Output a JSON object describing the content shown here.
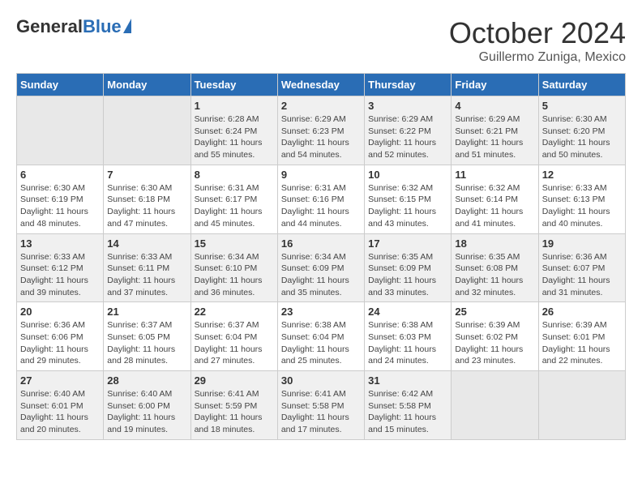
{
  "logo": {
    "general": "General",
    "blue": "Blue"
  },
  "title": {
    "month": "October 2024",
    "location": "Guillermo Zuniga, Mexico"
  },
  "weekdays": [
    "Sunday",
    "Monday",
    "Tuesday",
    "Wednesday",
    "Thursday",
    "Friday",
    "Saturday"
  ],
  "weeks": [
    [
      {
        "day": "",
        "empty": true
      },
      {
        "day": "",
        "empty": true
      },
      {
        "day": "1",
        "sunrise": "6:28 AM",
        "sunset": "6:24 PM",
        "daylight": "11 hours and 55 minutes."
      },
      {
        "day": "2",
        "sunrise": "6:29 AM",
        "sunset": "6:23 PM",
        "daylight": "11 hours and 54 minutes."
      },
      {
        "day": "3",
        "sunrise": "6:29 AM",
        "sunset": "6:22 PM",
        "daylight": "11 hours and 52 minutes."
      },
      {
        "day": "4",
        "sunrise": "6:29 AM",
        "sunset": "6:21 PM",
        "daylight": "11 hours and 51 minutes."
      },
      {
        "day": "5",
        "sunrise": "6:30 AM",
        "sunset": "6:20 PM",
        "daylight": "11 hours and 50 minutes."
      }
    ],
    [
      {
        "day": "6",
        "sunrise": "6:30 AM",
        "sunset": "6:19 PM",
        "daylight": "11 hours and 48 minutes."
      },
      {
        "day": "7",
        "sunrise": "6:30 AM",
        "sunset": "6:18 PM",
        "daylight": "11 hours and 47 minutes."
      },
      {
        "day": "8",
        "sunrise": "6:31 AM",
        "sunset": "6:17 PM",
        "daylight": "11 hours and 45 minutes."
      },
      {
        "day": "9",
        "sunrise": "6:31 AM",
        "sunset": "6:16 PM",
        "daylight": "11 hours and 44 minutes."
      },
      {
        "day": "10",
        "sunrise": "6:32 AM",
        "sunset": "6:15 PM",
        "daylight": "11 hours and 43 minutes."
      },
      {
        "day": "11",
        "sunrise": "6:32 AM",
        "sunset": "6:14 PM",
        "daylight": "11 hours and 41 minutes."
      },
      {
        "day": "12",
        "sunrise": "6:33 AM",
        "sunset": "6:13 PM",
        "daylight": "11 hours and 40 minutes."
      }
    ],
    [
      {
        "day": "13",
        "sunrise": "6:33 AM",
        "sunset": "6:12 PM",
        "daylight": "11 hours and 39 minutes."
      },
      {
        "day": "14",
        "sunrise": "6:33 AM",
        "sunset": "6:11 PM",
        "daylight": "11 hours and 37 minutes."
      },
      {
        "day": "15",
        "sunrise": "6:34 AM",
        "sunset": "6:10 PM",
        "daylight": "11 hours and 36 minutes."
      },
      {
        "day": "16",
        "sunrise": "6:34 AM",
        "sunset": "6:09 PM",
        "daylight": "11 hours and 35 minutes."
      },
      {
        "day": "17",
        "sunrise": "6:35 AM",
        "sunset": "6:09 PM",
        "daylight": "11 hours and 33 minutes."
      },
      {
        "day": "18",
        "sunrise": "6:35 AM",
        "sunset": "6:08 PM",
        "daylight": "11 hours and 32 minutes."
      },
      {
        "day": "19",
        "sunrise": "6:36 AM",
        "sunset": "6:07 PM",
        "daylight": "11 hours and 31 minutes."
      }
    ],
    [
      {
        "day": "20",
        "sunrise": "6:36 AM",
        "sunset": "6:06 PM",
        "daylight": "11 hours and 29 minutes."
      },
      {
        "day": "21",
        "sunrise": "6:37 AM",
        "sunset": "6:05 PM",
        "daylight": "11 hours and 28 minutes."
      },
      {
        "day": "22",
        "sunrise": "6:37 AM",
        "sunset": "6:04 PM",
        "daylight": "11 hours and 27 minutes."
      },
      {
        "day": "23",
        "sunrise": "6:38 AM",
        "sunset": "6:04 PM",
        "daylight": "11 hours and 25 minutes."
      },
      {
        "day": "24",
        "sunrise": "6:38 AM",
        "sunset": "6:03 PM",
        "daylight": "11 hours and 24 minutes."
      },
      {
        "day": "25",
        "sunrise": "6:39 AM",
        "sunset": "6:02 PM",
        "daylight": "11 hours and 23 minutes."
      },
      {
        "day": "26",
        "sunrise": "6:39 AM",
        "sunset": "6:01 PM",
        "daylight": "11 hours and 22 minutes."
      }
    ],
    [
      {
        "day": "27",
        "sunrise": "6:40 AM",
        "sunset": "6:01 PM",
        "daylight": "11 hours and 20 minutes."
      },
      {
        "day": "28",
        "sunrise": "6:40 AM",
        "sunset": "6:00 PM",
        "daylight": "11 hours and 19 minutes."
      },
      {
        "day": "29",
        "sunrise": "6:41 AM",
        "sunset": "5:59 PM",
        "daylight": "11 hours and 18 minutes."
      },
      {
        "day": "30",
        "sunrise": "6:41 AM",
        "sunset": "5:58 PM",
        "daylight": "11 hours and 17 minutes."
      },
      {
        "day": "31",
        "sunrise": "6:42 AM",
        "sunset": "5:58 PM",
        "daylight": "11 hours and 15 minutes."
      },
      {
        "day": "",
        "empty": true
      },
      {
        "day": "",
        "empty": true
      }
    ]
  ],
  "labels": {
    "sunrise": "Sunrise:",
    "sunset": "Sunset:",
    "daylight": "Daylight:"
  }
}
